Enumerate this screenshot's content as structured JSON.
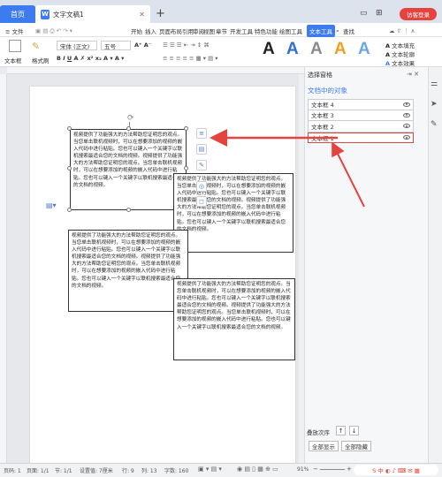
{
  "titlebar": {
    "home_tab": "首页",
    "doc_tab": "文字文稿1",
    "doc_icon": "W",
    "add_tab": "+",
    "login": "访客登录"
  },
  "menubar": {
    "file": "≡ 文件",
    "items": [
      "开始",
      "插入",
      "页面布局",
      "引用",
      "审阅",
      "视图",
      "章节",
      "开发工具",
      "特色功能",
      "绘图工具"
    ],
    "active": "文本工具",
    "search": "查找"
  },
  "ribbon": {
    "textbox_label": "文本框",
    "format_brush": "格式刷",
    "font_name": "宋体 (正文)",
    "font_size": "五号",
    "text_fill": "文本填充",
    "text_outline": "文本轮廓",
    "text_effect": "文本效果",
    "styles": [
      "A",
      "A",
      "A",
      "A",
      "A"
    ]
  },
  "textboxes": {
    "body": "视频提供了功能强大的方法帮助您证明您的观点。当您单击联机视频时，可以在想要添加的视频的嵌入代码中进行粘贴。您也可以键入一个关键字以联机搜索最适合您的文档的视频。视频提供了功能强大的方法帮助您证明您的观点。当您单击联机视频时，可以在想要添加的视频的嵌入代码中进行粘贴。您也可以键入一个关键字以联机搜索最适合您的文档的视频。",
    "box2": "视频提供了功能强大的方法帮助您证明您的观点。当您单击联机视频时，可以在想要添加的视频的嵌入代码中进行粘贴。您也可以键入一个关键字以联机搜索最适合您的文档的视频。视频提供了功能强大的方法帮助您证明您的观点。当您单击联机视频时，可以在想要添加的视频的嵌入代码中进行粘贴。您也可以键入一个关键字以联机搜索最适合您的文档的视频。"
  },
  "pane": {
    "title": "选择窗格",
    "subtitle": "文档中的对象",
    "objects": [
      {
        "label": "文本框 4",
        "selected": false
      },
      {
        "label": "文本框 3",
        "selected": false
      },
      {
        "label": "文本框 2",
        "selected": false
      },
      {
        "label": "文本框 1",
        "selected": true
      }
    ],
    "order_label": "叠放次序",
    "show_all": "全部显示",
    "hide_all": "全部隐藏"
  },
  "status": {
    "page": "页码: 1",
    "pages": "页面: 1/1",
    "section": "节: 1/1",
    "position": "设置值: 7厘米",
    "row": "行: 9",
    "col": "列: 13",
    "words": "字数: 160",
    "zoom": "91%"
  },
  "colors": {
    "accent": "#3d7cf0",
    "annotation": "#e5433e"
  }
}
